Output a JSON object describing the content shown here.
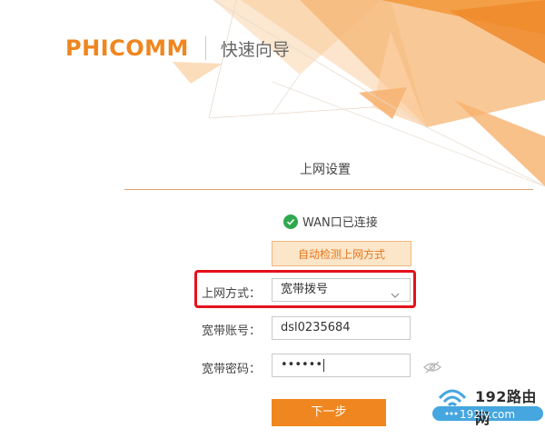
{
  "header": {
    "logo_text": "PHICOMM",
    "title": "快速向导"
  },
  "section": {
    "title": "上网设置"
  },
  "wan_status": {
    "text": "WAN口已连接",
    "icon": "check-circle-icon"
  },
  "detect_button": {
    "label": "自动检测上网方式"
  },
  "form": {
    "method_label": "上网方式：",
    "method_value": "宽带拨号",
    "account_label": "宽带账号：",
    "account_value": "dsl0235684",
    "password_label": "宽带密码：",
    "password_value": "••••••"
  },
  "next_button": {
    "label": "下一步"
  },
  "watermark": {
    "brand": "192路由网",
    "url": "192ly.com"
  },
  "colors": {
    "accent": "#f0861f",
    "highlight": "#e4121b",
    "success": "#2fa84f"
  }
}
